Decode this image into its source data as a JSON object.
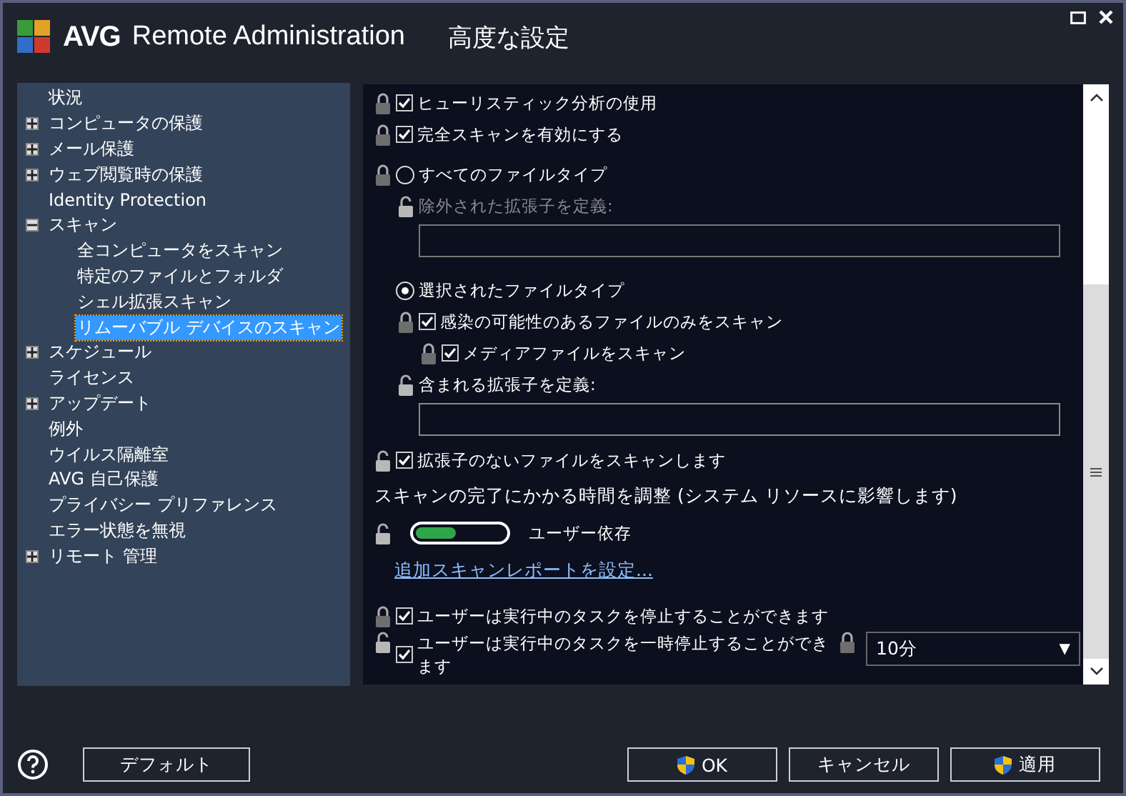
{
  "window": {
    "brand": "AVG",
    "product": "Remote Administration",
    "title": "高度な設定"
  },
  "tree": [
    {
      "label": "状況",
      "selected": false
    },
    {
      "label": "コンピュータの保護",
      "selected": false,
      "expanded": false
    },
    {
      "label": "メール保護",
      "selected": false,
      "expanded": false
    },
    {
      "label": "ウェブ閲覧時の保護",
      "selected": false,
      "expanded": false
    },
    {
      "label": "Identity Protection",
      "selected": false
    },
    {
      "label": "スキャン",
      "selected": false,
      "expanded": true,
      "children": [
        {
          "label": "全コンピュータをスキャン",
          "selected": false
        },
        {
          "label": "特定のファイルとフォルダ",
          "selected": false
        },
        {
          "label": "シェル拡張スキャン",
          "selected": false
        },
        {
          "label": "リムーバブル デバイスのスキャン",
          "selected": true
        }
      ]
    },
    {
      "label": "スケジュール",
      "selected": false,
      "expanded": false
    },
    {
      "label": "ライセンス",
      "selected": false
    },
    {
      "label": "アップデート",
      "selected": false,
      "expanded": false
    },
    {
      "label": "例外",
      "selected": false
    },
    {
      "label": "ウイルス隔離室",
      "selected": false
    },
    {
      "label": "AVG 自己保護",
      "selected": false
    },
    {
      "label": "プライバシー プリファレンス",
      "selected": false
    },
    {
      "label": "エラー状態を無視",
      "selected": false
    },
    {
      "label": "リモート 管理",
      "selected": false,
      "expanded": false
    }
  ],
  "settings": [
    {
      "kind": "checkbox",
      "locked": true,
      "label": "ヒューリスティック分析の使用",
      "checked": true
    },
    {
      "kind": "checkbox",
      "locked": true,
      "label": "完全スキャンを有効にする",
      "checked": true
    },
    {
      "kind": "radio",
      "locked": true,
      "label": "すべてのファイルタイプ",
      "selected": false,
      "children": [
        {
          "kind": "label",
          "locked": false,
          "label": "除外された拡張子を定義:",
          "disabled": true
        },
        {
          "kind": "field",
          "disabled": true
        }
      ]
    },
    {
      "kind": "radio",
      "label": "選択されたファイルタイプ",
      "selected": true,
      "children": [
        {
          "kind": "checkbox",
          "locked": true,
          "label": "感染の可能性のあるファイルのみをスキャン",
          "checked": true,
          "children": [
            {
              "kind": "checkbox",
              "locked": true,
              "label": "メディアファイルをスキャン",
              "checked": true
            }
          ]
        },
        {
          "kind": "label",
          "locked": false,
          "label": "含まれる拡張子を定義:",
          "disabled": false
        },
        {
          "kind": "field",
          "disabled": false
        }
      ]
    },
    {
      "kind": "checkbox",
      "locked": false,
      "label": "拡張子のないファイルをスキャンします",
      "checked": true
    },
    {
      "kind": "heading",
      "label": "スキャンの完了にかかる時間を調整 (システム リソースに影響します)"
    },
    {
      "kind": "slider",
      "locked": false,
      "level": 0.45,
      "reading": "ユーザー依存"
    },
    {
      "kind": "link",
      "label": "追加スキャンレポートを設定..."
    },
    {
      "kind": "checkbox",
      "locked": true,
      "label": "ユーザーは実行中のタスクを停止することができます",
      "checked": true
    },
    {
      "kind": "checkbox-select",
      "locked": false,
      "label": "ユーザーは実行中のタスクを一時停止することができます",
      "checked": true,
      "select_locked": true,
      "value": "10分",
      "arrow": "▼"
    }
  ],
  "buttons": [
    {
      "label": "デフォルト",
      "shield": false
    },
    {
      "label": "OK",
      "shield": true
    },
    {
      "label": "キャンセル",
      "shield": false
    },
    {
      "label": "適用",
      "shield": true
    }
  ]
}
